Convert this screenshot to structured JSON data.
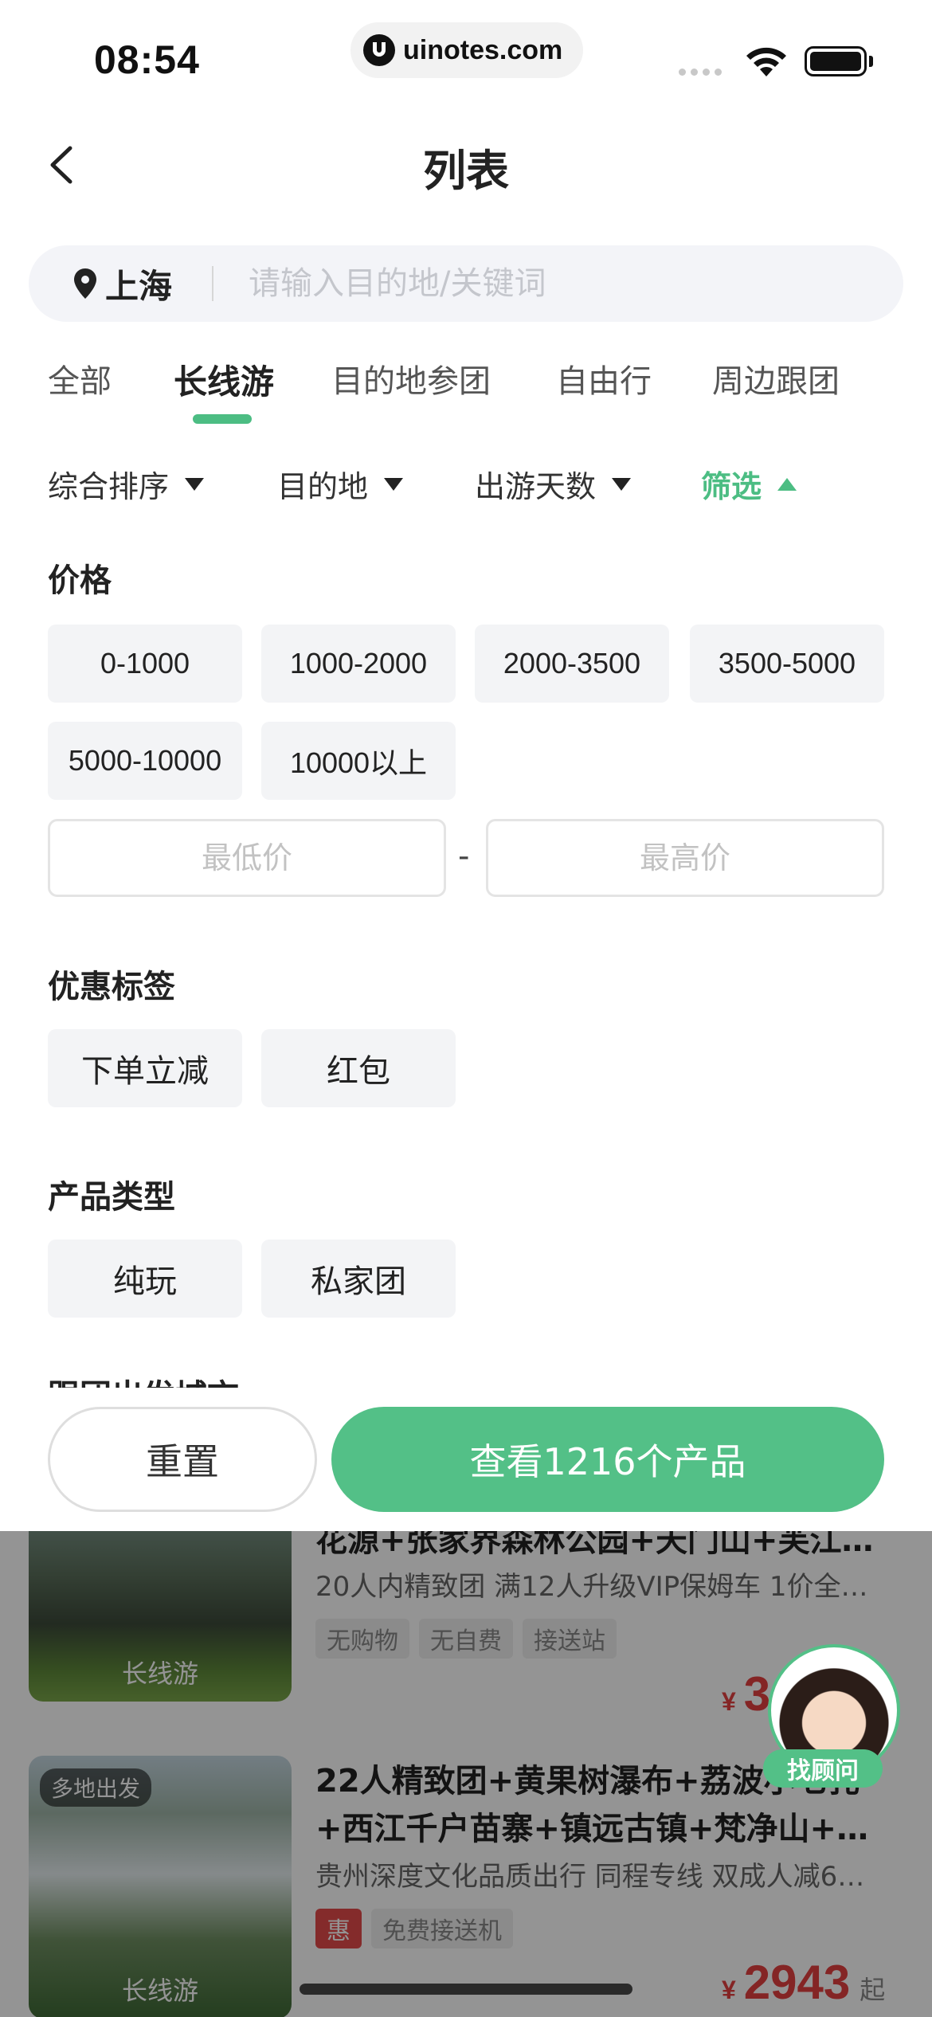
{
  "status_bar": {
    "time": "08:54",
    "url": "uinotes.com"
  },
  "nav": {
    "title": "列表"
  },
  "search": {
    "city": "上海",
    "placeholder": "请输入目的地/关键词"
  },
  "tabs": [
    {
      "label": "全部",
      "active": false
    },
    {
      "label": "长线游",
      "active": true
    },
    {
      "label": "目的地参团",
      "active": false
    },
    {
      "label": "自由行",
      "active": false
    },
    {
      "label": "周边跟团",
      "active": false
    }
  ],
  "filters": [
    {
      "label": "综合排序"
    },
    {
      "label": "目的地"
    },
    {
      "label": "出游天数"
    },
    {
      "label": "筛选",
      "active": true
    }
  ],
  "filter_panel": {
    "price": {
      "title": "价格",
      "options": [
        "0-1000",
        "1000-2000",
        "2000-3500",
        "3500-5000",
        "5000-10000",
        "10000以上"
      ],
      "min_placeholder": "最低价",
      "max_placeholder": "最高价",
      "separator": "-"
    },
    "discount": {
      "title": "优惠标签",
      "options": [
        "下单立减",
        "红包"
      ]
    },
    "product_type": {
      "title": "产品类型",
      "options": [
        "纯玩",
        "私家团"
      ]
    },
    "next_section_title": "跟团出发城市"
  },
  "actions": {
    "reset": "重置",
    "confirm": "查看1216个产品"
  },
  "list": [
    {
      "title": "花源+张家界森林公园+天门山+芙江…",
      "subtitle": "20人内精致团 满12人升级VIP保姆车 1价全…",
      "tags": [
        "无购物",
        "无自费",
        "接送站"
      ],
      "image_label": "长线游",
      "price_symbol": "¥",
      "price": "3"
    },
    {
      "badge": "多地出发",
      "title_line1": "22人精致团+黄果树瀑布+荔波小七孔",
      "title_line2": "+西江千户苗寨+镇远古镇+梵净山+甲…",
      "subtitle": "贵州深度文化品质出行 同程专线 双成人减6…",
      "tags": [
        "惠",
        "免费接送机"
      ],
      "image_label": "长线游",
      "price_symbol": "¥",
      "price": "2943",
      "price_suffix": "起"
    }
  ],
  "advisor": {
    "label": "找顾问"
  },
  "colors": {
    "accent": "#53c087",
    "price": "#e44141"
  }
}
